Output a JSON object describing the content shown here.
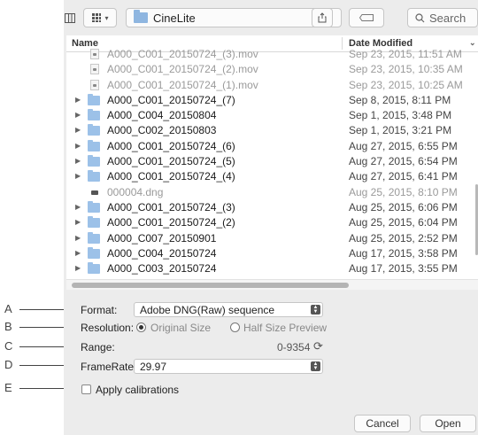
{
  "toolbar": {
    "location": "CineLite",
    "search_placeholder": "Search"
  },
  "list": {
    "header_name": "Name",
    "header_date": "Date Modified",
    "rows": [
      {
        "name": "A000_C001_20150724_(3).mov",
        "date": "Sep 23, 2015, 11:51 AM",
        "kind": "mov",
        "dim": true
      },
      {
        "name": "A000_C001_20150724_(2).mov",
        "date": "Sep 23, 2015, 10:35 AM",
        "kind": "mov",
        "dim": true
      },
      {
        "name": "A000_C001_20150724_(1).mov",
        "date": "Sep 23, 2015, 10:25 AM",
        "kind": "mov",
        "dim": true
      },
      {
        "name": "A000_C001_20150724_(7)",
        "date": "Sep 8, 2015, 8:11 PM",
        "kind": "folder",
        "dim": false
      },
      {
        "name": "A000_C004_20150804",
        "date": "Sep 1, 2015, 3:48 PM",
        "kind": "folder",
        "dim": false
      },
      {
        "name": "A000_C002_20150803",
        "date": "Sep 1, 2015, 3:21 PM",
        "kind": "folder",
        "dim": false
      },
      {
        "name": "A000_C001_20150724_(6)",
        "date": "Aug 27, 2015, 6:55 PM",
        "kind": "folder",
        "dim": false
      },
      {
        "name": "A000_C001_20150724_(5)",
        "date": "Aug 27, 2015, 6:54 PM",
        "kind": "folder",
        "dim": false
      },
      {
        "name": "A000_C001_20150724_(4)",
        "date": "Aug 27, 2015, 6:41 PM",
        "kind": "folder",
        "dim": false
      },
      {
        "name": "000004.dng",
        "date": "Aug 25, 2015, 8:10 PM",
        "kind": "dng",
        "dim": true
      },
      {
        "name": "A000_C001_20150724_(3)",
        "date": "Aug 25, 2015, 6:06 PM",
        "kind": "folder",
        "dim": false
      },
      {
        "name": "A000_C001_20150724_(2)",
        "date": "Aug 25, 2015, 6:04 PM",
        "kind": "folder",
        "dim": false
      },
      {
        "name": "A000_C007_20150901",
        "date": "Aug 25, 2015, 2:52 PM",
        "kind": "folder",
        "dim": false
      },
      {
        "name": "A000_C004_20150724",
        "date": "Aug 17, 2015, 3:58 PM",
        "kind": "folder",
        "dim": false
      },
      {
        "name": "A000_C003_20150724",
        "date": "Aug 17, 2015, 3:55 PM",
        "kind": "folder",
        "dim": false
      }
    ]
  },
  "options": {
    "format_label": "Format:",
    "format_value": "Adobe DNG(Raw) sequence",
    "resolution_label": "Resolution:",
    "resolution_original": "Original Size",
    "resolution_half": "Half Size Preview",
    "range_label": "Range:",
    "range_value": "0-9354",
    "framerate_label": "FrameRate:",
    "framerate_value": "29.97",
    "calibrations_label": "Apply calibrations"
  },
  "buttons": {
    "cancel": "Cancel",
    "open": "Open"
  },
  "callouts": [
    "A",
    "B",
    "C",
    "D",
    "E"
  ],
  "icons": {
    "view": "column-view-icon",
    "arrange": "grid-arrange-icon",
    "share": "share-icon",
    "tag": "tag-icon",
    "search": "search-icon",
    "refresh": "refresh-icon"
  }
}
